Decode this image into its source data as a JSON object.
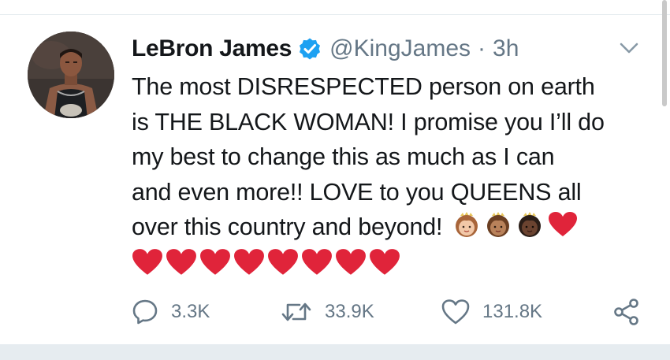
{
  "tweet": {
    "display_name": "LeBron James",
    "handle": "@KingJames",
    "separator": "·",
    "timestamp": "3h",
    "verified": true,
    "text_lines": [
      "The most DISRESPECTED person on earth",
      "is THE BLACK WOMAN! I promise you I’ll do",
      "my best to change this as much as I can",
      "and even more!! LOVE to you QUEENS all",
      "over this country and beyond!"
    ],
    "emojis": [
      "princess-light-skin",
      "princess-medium-skin",
      "princess-dark-skin",
      "red-heart"
    ],
    "heart_count": 8
  },
  "actions": {
    "replies": "3.3K",
    "retweets": "33.9K",
    "likes": "131.8K"
  },
  "icons": {
    "avatar": "avatar-photo",
    "verified": "verified-badge-icon",
    "caret": "chevron-down-icon",
    "reply": "reply-icon",
    "retweet": "retweet-icon",
    "like": "heart-icon",
    "share": "share-icon"
  },
  "colors": {
    "text": "#14171a",
    "secondary": "#657786",
    "verified": "#1da1f2",
    "heart": "#e0243a",
    "divider": "#e6ecf0"
  }
}
